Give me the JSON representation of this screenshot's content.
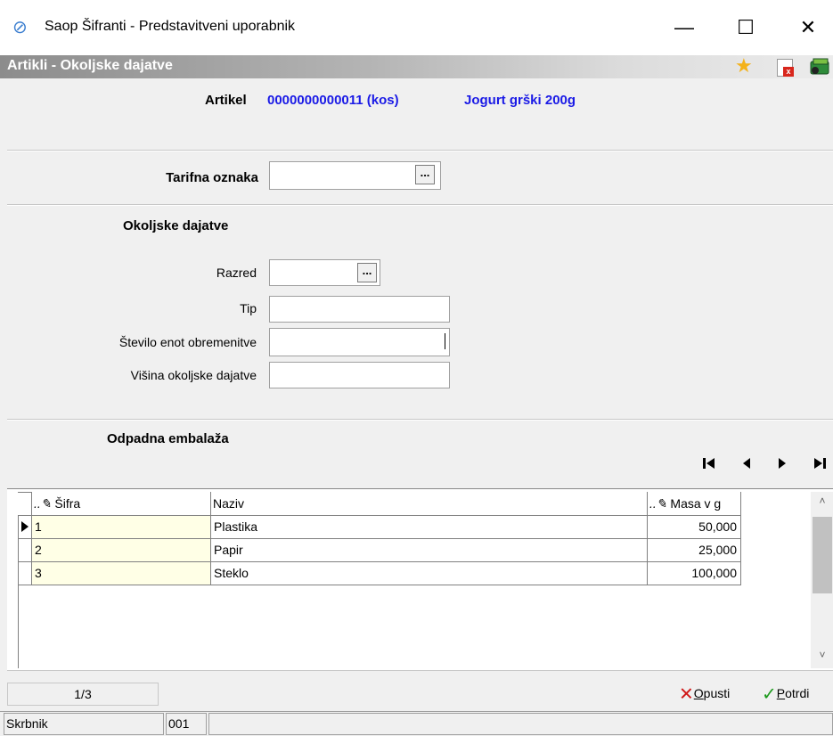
{
  "window": {
    "title": "Saop Šifranti - Predstavitveni uporabnik",
    "minimize_glyph": "—",
    "maximize_glyph": "☐",
    "close_glyph": "✕"
  },
  "header": {
    "title": "Artikli - Okoljske dajatve",
    "icons": [
      "star-icon",
      "pdf-icon",
      "book-icon"
    ]
  },
  "article": {
    "label": "Artikel",
    "code": "0000000000011 (kos)",
    "name": "Jogurt grški 200g",
    "accent_color": "#1a1ae6"
  },
  "tariff": {
    "label": "Tarifna oznaka",
    "value": "",
    "button": "..."
  },
  "eco": {
    "heading": "Okoljske dajatve",
    "razred_label": "Razred",
    "razred_value": "",
    "razred_button": "...",
    "tip_label": "Tip",
    "tip_value": "",
    "stevilo_label": "Število enot obremenitve",
    "stevilo_value": "",
    "visina_label": "Višina okoljske dajatve",
    "visina_value": ""
  },
  "packaging": {
    "heading": "Odpadna embalaža",
    "nav": [
      "first-record",
      "previous-record",
      "next-record",
      "last-record"
    ],
    "columns": [
      "Šifra",
      "Naziv",
      "Masa v g"
    ],
    "rows": [
      {
        "sifra": "1",
        "naziv": "Plastika",
        "masa": "50,000"
      },
      {
        "sifra": "2",
        "naziv": "Papir",
        "masa": "25,000"
      },
      {
        "sifra": "3",
        "naziv": "Steklo",
        "masa": "100,000"
      }
    ]
  },
  "footer": {
    "page_indicator": "1/3",
    "cancel_label": "Opusti",
    "cancel_accel": "O",
    "cancel_rest": "pusti",
    "confirm_label": "Potrdi",
    "confirm_accel": "P",
    "confirm_rest": "otrdi"
  },
  "status": {
    "user_label": "Skrbnik",
    "code": "001"
  }
}
